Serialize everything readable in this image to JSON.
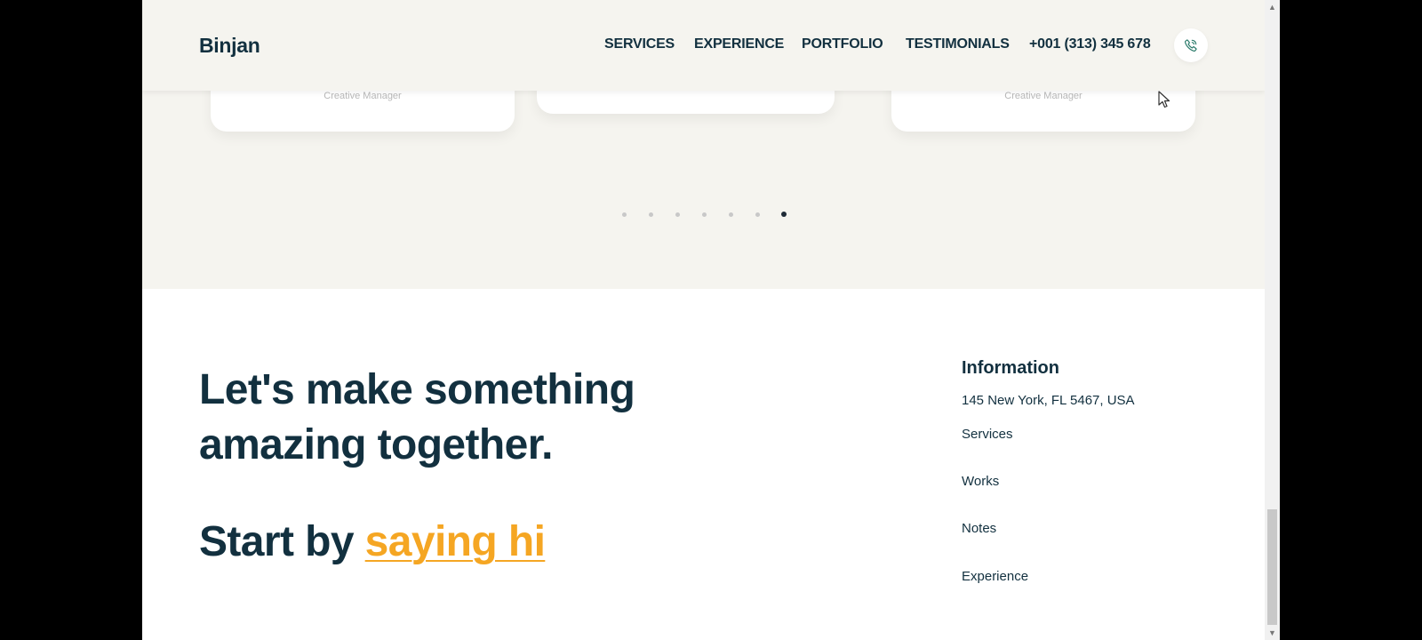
{
  "header": {
    "logo": "Binjan",
    "nav": {
      "services": "SERVICES",
      "experience": "EXPERIENCE",
      "portfolio": "PORTFOLIO",
      "testimonials": "TESTIMONIALS",
      "phone": "+001 (313) 345 678"
    },
    "phone_icon": "phone-icon"
  },
  "testimonials": {
    "cards": [
      {
        "role": "Creative Manager"
      },
      {
        "role": ""
      },
      {
        "role": "Creative Manager"
      }
    ],
    "pagination": {
      "count": 7,
      "active_index": 6
    }
  },
  "contact": {
    "headline_line1": "Let's make something",
    "headline_line2": "amazing together.",
    "cta_prefix": "Start by ",
    "cta_link": "saying hi"
  },
  "information": {
    "title": "Information",
    "address": "145 New York, FL 5467, USA",
    "links": [
      "Services",
      "Works",
      "Notes",
      "Experience"
    ]
  },
  "colors": {
    "primary_text": "#12303f",
    "accent": "#f5a623",
    "section_bg": "#f5f4ef"
  }
}
